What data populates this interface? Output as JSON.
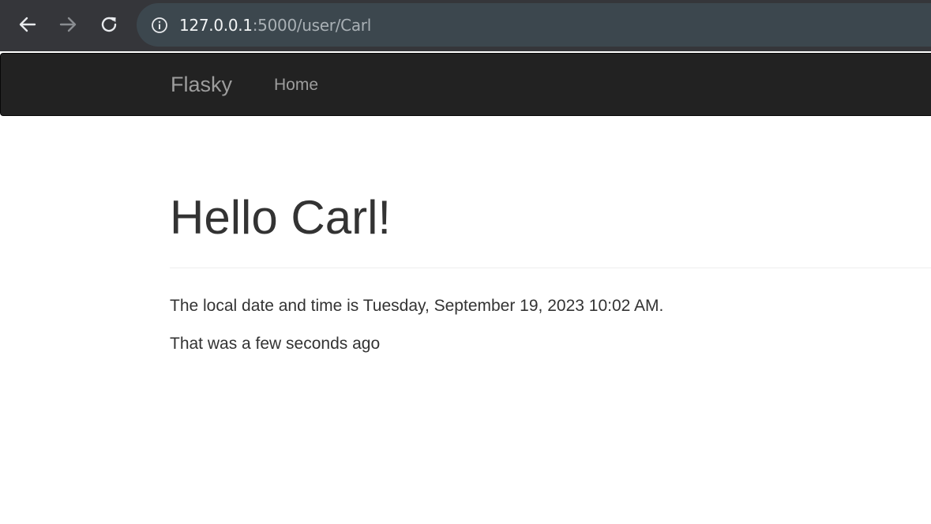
{
  "browser": {
    "url_host": "127.0.0.1",
    "url_path": ":5000/user/Carl",
    "icons": {
      "back": "arrow-left-icon",
      "forward": "arrow-right-icon",
      "reload": "reload-icon",
      "info": "info-circle-icon"
    }
  },
  "navbar": {
    "brand": "Flasky",
    "links": [
      {
        "label": "Home"
      }
    ]
  },
  "main": {
    "title": "Hello Carl!",
    "local_time_line": "The local date and time is Tuesday, September 19, 2023 10:02 AM.",
    "relative_time_line": "That was a few seconds ago"
  },
  "colors": {
    "browser_chrome": "#35363a",
    "address_bar": "#3c474e",
    "navbar_bg": "#222222",
    "navbar_text": "#9d9d9d",
    "body_text": "#333333"
  }
}
